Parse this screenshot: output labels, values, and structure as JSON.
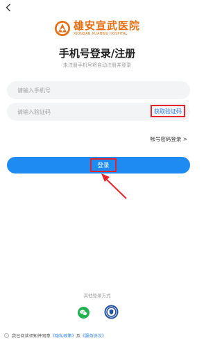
{
  "header": {
    "back_icon": "chevron-left-icon"
  },
  "logo": {
    "name_cn": "雄安宣武医院",
    "name_en": "XIONGAN XUANWU HOSPITAL",
    "brand_color": "#E46F14"
  },
  "title": "手机号登录/注册",
  "subtitle": "未注册手机号将自动注册并登录",
  "phone_field": {
    "placeholder": "请输入手机号"
  },
  "code_field": {
    "placeholder": "请输入验证码",
    "get_code_label": "获取验证码"
  },
  "password_login_link": "帐号密码登录 >",
  "login_button": {
    "label": "登录",
    "color": "#1E8BF3"
  },
  "other_login": {
    "title": "其他登录方式",
    "methods": [
      "wechat-icon",
      "gov-id-icon"
    ]
  },
  "agreement": {
    "prefix": "我已阅读须知并同意",
    "privacy": "《隐私政策》",
    "and": "及",
    "service": "《服务协议》"
  },
  "annotation_color": "#E6232A"
}
